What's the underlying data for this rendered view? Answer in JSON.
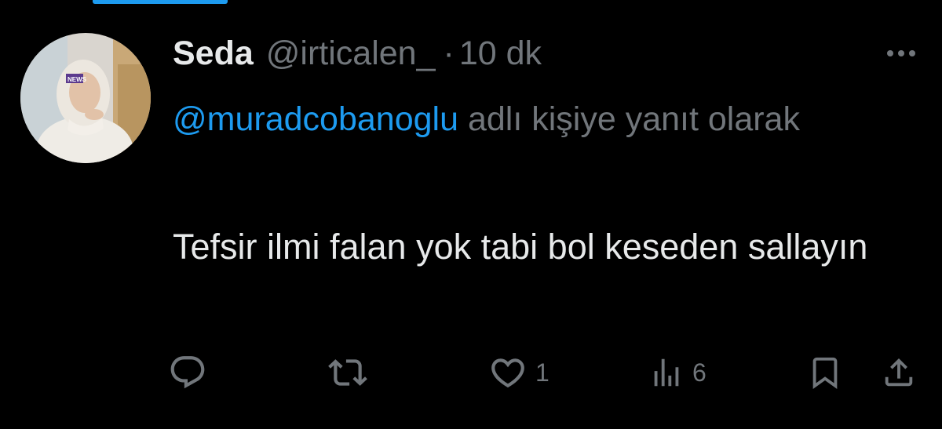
{
  "tweet": {
    "name": "Seda",
    "handle": "@irticalen_",
    "separator": "·",
    "time": "10 dk",
    "reply_mention": "@muradcobanoglu",
    "reply_suffix": " adlı kişiye yanıt olarak",
    "text": "Tefsir ilmi falan yok tabi bol keseden sallayın",
    "avatar_badge": "NEWS"
  },
  "actions": {
    "reply": {
      "icon": "reply-icon"
    },
    "retweet": {
      "icon": "retweet-icon"
    },
    "like": {
      "icon": "heart-icon",
      "count": "1"
    },
    "views": {
      "icon": "views-icon",
      "count": "6"
    },
    "bookmark": {
      "icon": "bookmark-icon"
    },
    "share": {
      "icon": "share-icon"
    }
  },
  "colors": {
    "background": "#000000",
    "text": "#e7e9ea",
    "secondary": "#71767b",
    "accent": "#1d9bf0"
  }
}
